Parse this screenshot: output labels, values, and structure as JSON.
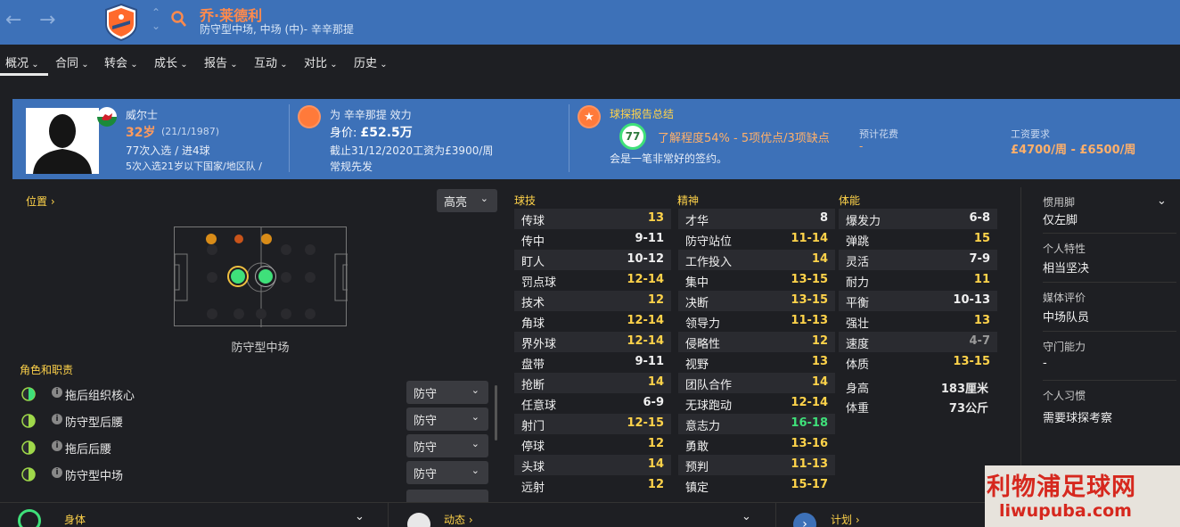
{
  "header": {
    "player_name": "乔·莱德利",
    "player_positions": "防守型中场, 中场 (中)- 辛辛那提",
    "back_label": "←",
    "forward_label": "→"
  },
  "tabs": [
    "概况",
    "合同",
    "转会",
    "成长",
    "报告",
    "互动",
    "对比",
    "历史"
  ],
  "overview": {
    "nationality": "威尔士",
    "age": "32岁",
    "dob": "(21/1/1987)",
    "caps": "77次入选 / 进4球",
    "u21": "5次入选21岁以下国家/地区队 /",
    "club_label": "为 辛辛那提 效力",
    "value_label": "身价: ",
    "value": "£52.5万",
    "contract": "截止31/12/2020工资为£3900/周",
    "role": "常规先发",
    "scout_title": "球探报告总结",
    "scout_score": "77",
    "knowledge": "了解程度54% - 5项优点/3项缺点",
    "scout_note": "会是一笔非常好的签约。",
    "fee_label": "预计花费",
    "fee_value": "-",
    "wage_label": "工资要求",
    "wage_value": "£4700/周 - £6500/周"
  },
  "position": {
    "label": "位置",
    "highlight": "高亮",
    "position_name": "防守型中场",
    "roles_title": "角色和职责",
    "roles": [
      {
        "name": "拖后组织核心",
        "duty": "防守"
      },
      {
        "name": "防守型后腰",
        "duty": "防守"
      },
      {
        "name": "拖后后腰",
        "duty": "防守"
      },
      {
        "name": "防守型中场",
        "duty": "防守"
      }
    ]
  },
  "attributes": {
    "technical_title": "球技",
    "mental_title": "精神",
    "physical_title": "体能",
    "technical": [
      {
        "n": "传球",
        "v": "13",
        "c": "yel"
      },
      {
        "n": "传中",
        "v": "9-11",
        "c": "wht"
      },
      {
        "n": "盯人",
        "v": "10-12",
        "c": "wht"
      },
      {
        "n": "罚点球",
        "v": "12-14",
        "c": "yel"
      },
      {
        "n": "技术",
        "v": "12",
        "c": "yel"
      },
      {
        "n": "角球",
        "v": "12-14",
        "c": "yel"
      },
      {
        "n": "界外球",
        "v": "12-14",
        "c": "yel"
      },
      {
        "n": "盘带",
        "v": "9-11",
        "c": "wht"
      },
      {
        "n": "抢断",
        "v": "14",
        "c": "yel"
      },
      {
        "n": "任意球",
        "v": "6-9",
        "c": "wht"
      },
      {
        "n": "射门",
        "v": "12-15",
        "c": "yel"
      },
      {
        "n": "停球",
        "v": "12",
        "c": "yel"
      },
      {
        "n": "头球",
        "v": "14",
        "c": "yel"
      },
      {
        "n": "远射",
        "v": "12",
        "c": "yel"
      }
    ],
    "mental": [
      {
        "n": "才华",
        "v": "8",
        "c": "wht"
      },
      {
        "n": "防守站位",
        "v": "11-14",
        "c": "yel"
      },
      {
        "n": "工作投入",
        "v": "14",
        "c": "yel"
      },
      {
        "n": "集中",
        "v": "13-15",
        "c": "yel"
      },
      {
        "n": "决断",
        "v": "13-15",
        "c": "yel"
      },
      {
        "n": "领导力",
        "v": "11-13",
        "c": "yel"
      },
      {
        "n": "侵略性",
        "v": "12",
        "c": "yel"
      },
      {
        "n": "视野",
        "v": "13",
        "c": "yel"
      },
      {
        "n": "团队合作",
        "v": "14",
        "c": "yel"
      },
      {
        "n": "无球跑动",
        "v": "12-14",
        "c": "yel"
      },
      {
        "n": "意志力",
        "v": "16-18",
        "c": "grn"
      },
      {
        "n": "勇敢",
        "v": "13-16",
        "c": "yel"
      },
      {
        "n": "预判",
        "v": "11-13",
        "c": "yel"
      },
      {
        "n": "镇定",
        "v": "15-17",
        "c": "yel"
      }
    ],
    "physical": [
      {
        "n": "爆发力",
        "v": "6-8",
        "c": "wht"
      },
      {
        "n": "弹跳",
        "v": "15",
        "c": "yel"
      },
      {
        "n": "灵活",
        "v": "7-9",
        "c": "wht"
      },
      {
        "n": "耐力",
        "v": "11",
        "c": "yel"
      },
      {
        "n": "平衡",
        "v": "10-13",
        "c": "wht"
      },
      {
        "n": "强壮",
        "v": "13",
        "c": "yel"
      },
      {
        "n": "速度",
        "v": "4-7",
        "c": "gry"
      },
      {
        "n": "体质",
        "v": "13-15",
        "c": "yel"
      }
    ],
    "height_label": "身高",
    "height_value": "183厘米",
    "weight_label": "体重",
    "weight_value": "73公斤"
  },
  "right_panel": {
    "foot_label": "惯用脚",
    "foot_value": "仅左脚",
    "trait_label": "个人特性",
    "trait_value": "相当坚决",
    "media_label": "媒体评价",
    "media_value": "中场队员",
    "gk_label": "守门能力",
    "gk_value": "-",
    "habit_label": "个人习惯",
    "habit_value": "需要球探考察"
  },
  "bottom": {
    "body_label": "身体",
    "dyn_label": "动态",
    "plan_label": "计划"
  },
  "watermark": {
    "cn": "利物浦足球网",
    "url": "liwupuba.com"
  },
  "colors": {
    "header_blue": "#3d71b8",
    "accent_orange": "#ff7a3a",
    "attr_yellow": "#ffd34a",
    "attr_green": "#3fe07a"
  }
}
